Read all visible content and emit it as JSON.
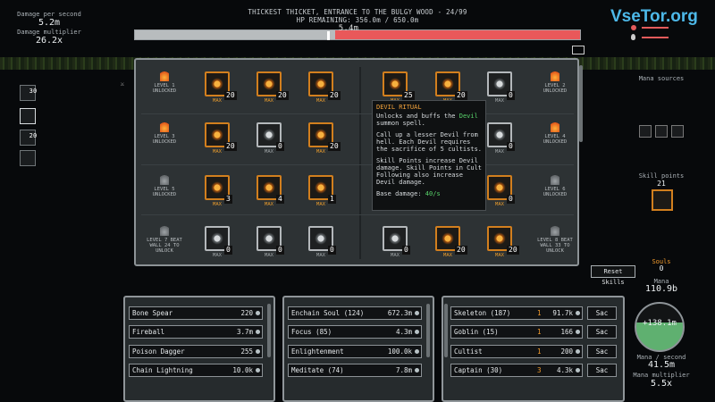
{
  "stats": {
    "dps_label": "Damage per second",
    "dps_value": "5.2m",
    "mult_label": "Damage multiplier",
    "mult_value": "26.2x"
  },
  "zone": {
    "title": "THICKEST THICKET, ENTRANCE TO THE BULGY WOOD - 24/99",
    "hp_text": "HP REMAINING: 356.0m / 650.0m",
    "floating": "5.4m",
    "hp_fraction": 0.45
  },
  "watermark": "VseTor.org",
  "right_panel": {
    "mana_sources": "Mana sources",
    "skill_points_label": "Skill points",
    "skill_points_value": "21",
    "reset_button": "Reset Skills",
    "souls_label": "Souls",
    "souls_value": "0",
    "mana_label": "Mana",
    "mana_value": "110.9b",
    "orb_value": "+138.1m",
    "mana_sec_label": "Mana / second",
    "mana_sec_value": "41.5m",
    "mana_mult_label": "Mana multiplier",
    "mana_mult_value": "5.5x"
  },
  "skill_levels": {
    "l1": "LEVEL 1 UNLOCKED",
    "l2": "LEVEL 2 UNLOCKED",
    "l3": "LEVEL 3 UNLOCKED",
    "l4": "LEVEL 4 UNLOCKED",
    "l5": "LEVEL 5 UNLOCKED",
    "l6": "LEVEL 6 UNLOCKED",
    "l7": "LEVEL 7 BEAT WALL 24 TO UNLOCK",
    "l8": "LEVEL 8 BEAT WALL 33 TO UNLOCK"
  },
  "skills": {
    "max": "MAX",
    "counts": [
      "20",
      "20",
      "20",
      "25",
      "20",
      "0",
      "20",
      "0",
      "20",
      "20",
      "0",
      "0",
      "3",
      "4",
      "1",
      "20",
      "0",
      "0",
      "0",
      "0",
      "0",
      "0",
      "20",
      "20"
    ]
  },
  "tooltip": {
    "title": "DEVIL RITUAL",
    "line1": "Unlocks and buffs the",
    "devil": "Devil",
    "line1b": "summon spell.",
    "body": "Call up a lesser Devil from hell. Each Devil requires the sacrifice of 5 cultists.",
    "body2": "Skill Points increase Devil damage. Skill Points in Cult Following also increase Devil damage.",
    "base_label": "Base damage:",
    "base_value": "40/s"
  },
  "spells": [
    {
      "name": "Bone Spear",
      "value": "220"
    },
    {
      "name": "Fireball",
      "value": "3.7m"
    },
    {
      "name": "Poison Dagger",
      "value": "255"
    },
    {
      "name": "Chain Lightning",
      "value": "10.0k"
    }
  ],
  "upgrades": [
    {
      "name": "Enchain Soul (124)",
      "value": "672.3m"
    },
    {
      "name": "Focus (85)",
      "value": "4.3m"
    },
    {
      "name": "Enlightenment",
      "value": "100.0k"
    },
    {
      "name": "Meditate (74)",
      "value": "7.8m"
    }
  ],
  "minions": [
    {
      "name": "Skeleton (187)",
      "cost": "1",
      "value": "91.7k",
      "sac": "Sac"
    },
    {
      "name": "Goblin (15)",
      "cost": "1",
      "value": "166",
      "sac": "Sac"
    },
    {
      "name": "Cultist",
      "cost": "1",
      "value": "200",
      "sac": "Sac"
    },
    {
      "name": "Captain (30)",
      "cost": "3",
      "value": "4.3k",
      "sac": "Sac"
    }
  ],
  "left_counts": [
    "30",
    "20"
  ],
  "colors": {
    "accent_orange": "#d27f1e",
    "hp_red": "#e9585a",
    "mana_green": "#5fb070"
  }
}
